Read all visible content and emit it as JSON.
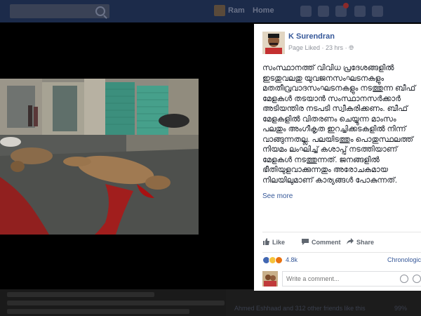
{
  "topbar": {
    "nav_items": [
      "Ram",
      "Home"
    ],
    "colors": {
      "bar": "#1c2b4a"
    }
  },
  "post": {
    "author": "K Surendran",
    "meta_liked": "Page Liked",
    "meta_sep": " · ",
    "meta_time": "23 hrs",
    "meta_privacy_icon": "globe-icon",
    "text": "സംസ്ഥാനത്ത് വിവിധ പ്രദേശങ്ങളിൽ ഇടതുവലതു യുവജനസംഘടനകളും മതതീവ്രവാദസംഘടനകളും നടത്തുന്ന ബീഫ് മേളകൾ തടയാൻ സംസ്ഥാനസർക്കാർ അടിയന്തിര നടപടി സ്വീകരിക്കണം. ബീഫ് മേളകളിൽ വിതരണം ചെയ്യുന്ന മാംസം പലതും അംഗീകൃത ഇറച്ചിക്കടകളിൽ നിന്ന് വാങ്ങുന്നതല്ല. പലയിടത്തും പൊതുസ്ഥലത്ത് നിയമം ലംഘിച്ച് കശാപ്പ് നടത്തിയാണ് മേളകൾ നടത്തുന്നത്. ജനങ്ങളിൽ ഭീതിയുളവാക്കുന്നതും അരോചകമായ നിലയിലുമാണ് കാര്യങ്ങൾ പോകുന്നത്. പ്രകോപനപരമാണ് പല പ...",
    "see_more": "See more",
    "actions": {
      "like": "Like",
      "comment": "Comment",
      "share": "Share"
    },
    "reaction_count": "4.8k",
    "sort_label": "Chronologic",
    "comment_placeholder": "Write a comment..."
  },
  "colors": {
    "link": "#365899",
    "text": "#1d2129",
    "meta": "#90949c",
    "like_reaction": "#4267b2",
    "sad_reaction": "#f5c33b",
    "angry_reaction": "#e9710f"
  },
  "background_feed": {
    "right_lines": [
      "Ahmed Eshhaad and 312 other friends like this",
      "99%"
    ]
  }
}
